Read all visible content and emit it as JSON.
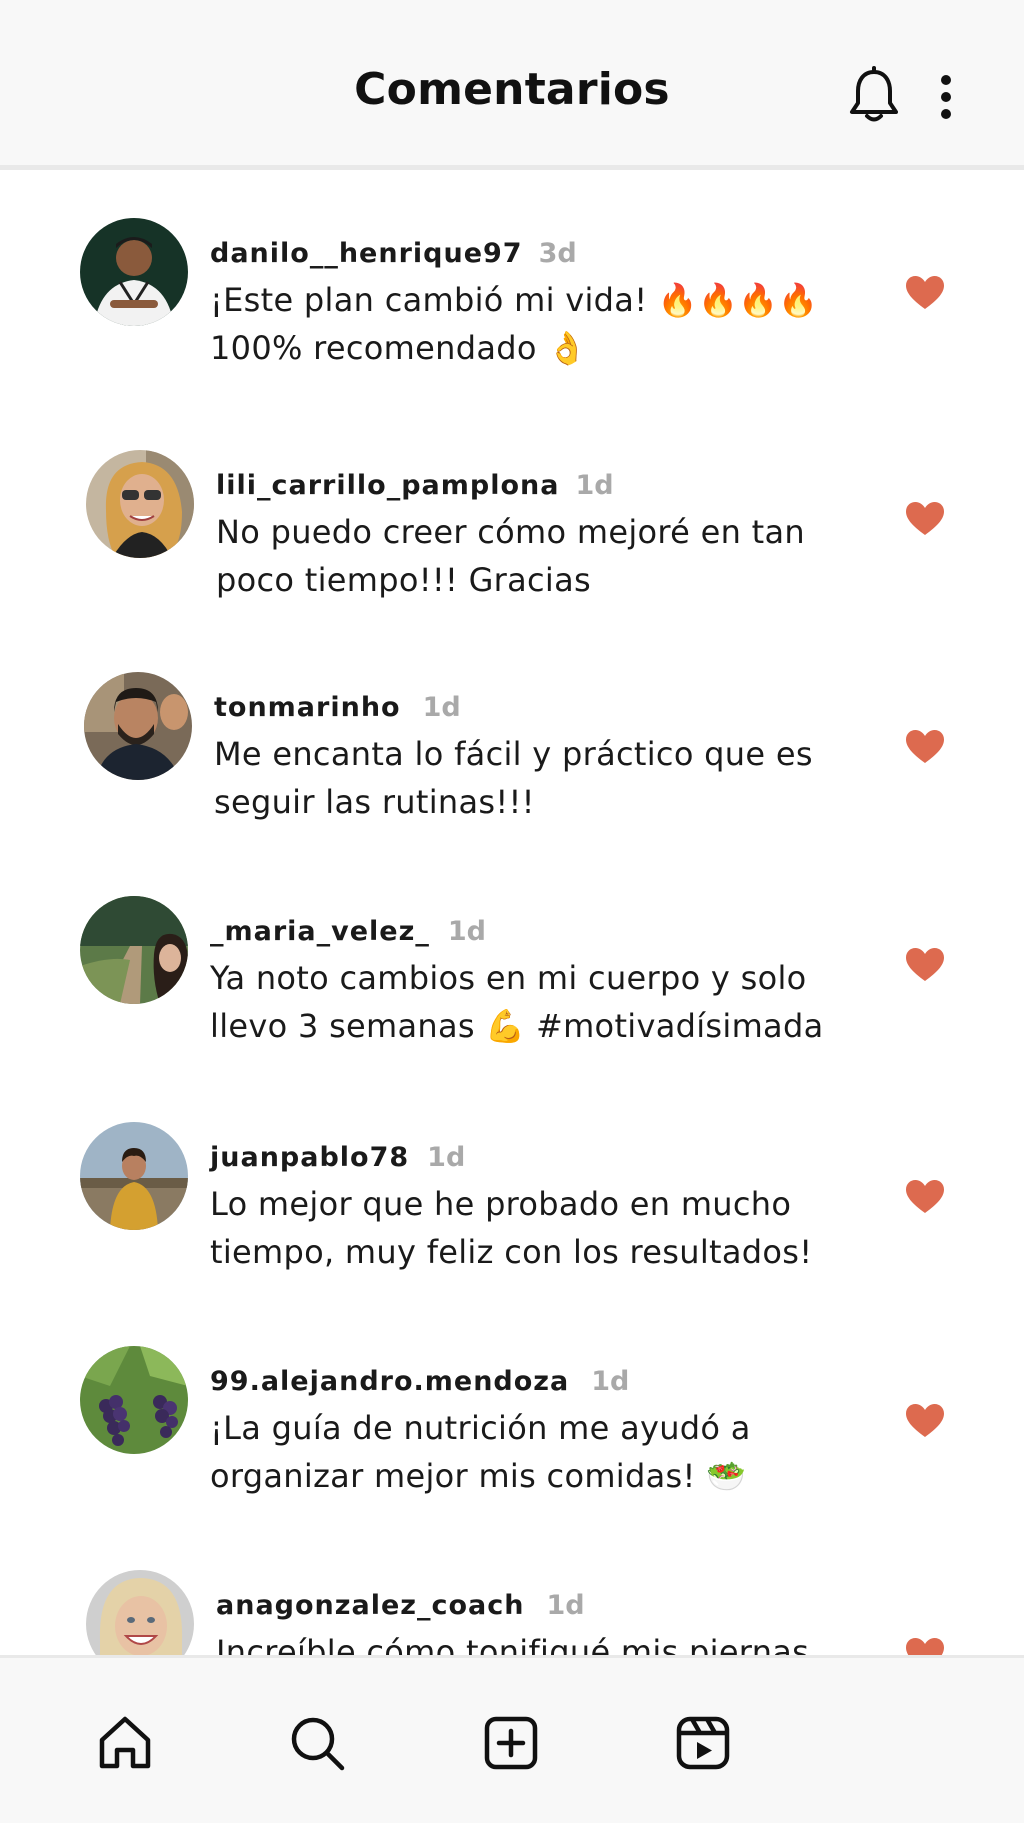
{
  "header": {
    "title": "Comentarios",
    "icons": [
      "bell-icon",
      "more-vertical-icon"
    ]
  },
  "accent_color": "#dd6a4f",
  "comments": [
    {
      "username": "danilo__henrique97",
      "time": "3d",
      "text_line1": "¡Este plan cambió mi vida! 🔥🔥🔥🔥",
      "text_line2": "100% recomendado 👌",
      "liked": true
    },
    {
      "username": "lili_carrillo_pamplona",
      "time": "1d",
      "text_line1": "No puedo creer cómo mejoré en tan",
      "text_line2": "poco tiempo!!! Gracias",
      "liked": true
    },
    {
      "username": "tonmarinho",
      "time": "1d",
      "text_line1": "Me encanta lo fácil y práctico que es",
      "text_line2": "seguir las rutinas!!!",
      "liked": true
    },
    {
      "username": "_maria_velez_",
      "time": "1d",
      "text_line1": "Ya noto cambios en mi cuerpo y solo",
      "text_line2": "llevo 3 semanas 💪 #motivadísimada",
      "liked": true
    },
    {
      "username": "juanpablo78",
      "time": "1d",
      "text_line1": "Lo mejor que he probado en mucho",
      "text_line2": "tiempo, muy feliz con los resultados!",
      "liked": true
    },
    {
      "username": "99.alejandro.mendoza",
      "time": "1d",
      "text_line1": "¡La guía de nutrición me ayudó a",
      "text_line2": "organizar mejor mis comidas! 🥗",
      "liked": true
    },
    {
      "username": "anagonzalez_coach",
      "time": "1d",
      "text_line1": "Increíble cómo tonifiqué mis piernas",
      "text_line2": "",
      "liked": true
    }
  ],
  "bottom_nav": [
    "home-icon",
    "search-icon",
    "add-post-icon",
    "reels-icon"
  ]
}
